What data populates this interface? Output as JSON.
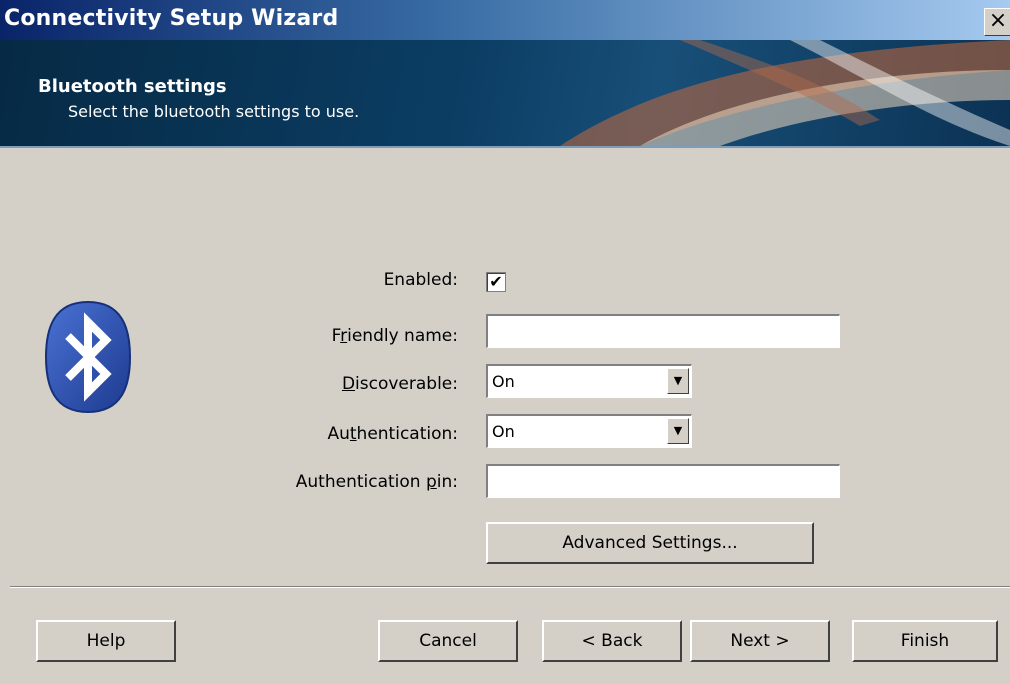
{
  "window": {
    "title": "Connectivity Setup Wizard",
    "close_glyph": "×"
  },
  "banner": {
    "heading": "Bluetooth settings",
    "subtitle": "Select the bluetooth settings to use."
  },
  "form": {
    "enabled": {
      "label": "Enabled:",
      "checked": true
    },
    "friendly_name": {
      "label_pre": "F",
      "label_u": "r",
      "label_post": "iendly name:",
      "value": ""
    },
    "discoverable": {
      "label_pre": "",
      "label_u": "D",
      "label_post": "iscoverable:",
      "value": "On"
    },
    "authentication": {
      "label_pre": "Au",
      "label_u": "t",
      "label_post": "hentication:",
      "value": "On"
    },
    "authentication_pin": {
      "label_pre": "Authentication ",
      "label_u": "p",
      "label_post": "in:",
      "value": ""
    },
    "advanced_button": "Advanced Settings..."
  },
  "footer": {
    "help": "Help",
    "cancel": "Cancel",
    "back": "< Back",
    "next": "Next >",
    "finish": "Finish"
  },
  "icons": {
    "bluetooth": "bluetooth-icon",
    "checkbox_mark": "✔",
    "dropdown_arrow": "▼"
  },
  "colors": {
    "banner": "#0b3d63",
    "bluetooth_blue": "#2b4fb3",
    "face": "#d4d0c8"
  }
}
